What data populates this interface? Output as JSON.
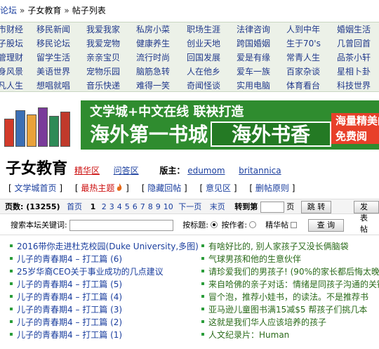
{
  "breadcrumb": {
    "items": [
      "论坛",
      "子女教育",
      "帖子列表"
    ],
    "separator": "»"
  },
  "categories": [
    [
      "市财经",
      "移民新闻",
      "我爱我家",
      "私房小菜",
      "职场生涯",
      "法律咨询",
      "人到中年",
      "婚姻生活"
    ],
    [
      "子股坛",
      "移民论坛",
      "我爱宠物",
      "健康养生",
      "创业天地",
      "跨国婚姻",
      "生于70's",
      "几曾回首"
    ],
    [
      "管理财",
      "留学生活",
      "亲亲宝贝",
      "流行时尚",
      "回国发展",
      "爱是有缘",
      "常青人生",
      "品茶小轩"
    ],
    [
      "身风景",
      "美语世界",
      "宠物乐园",
      "脑筋急转",
      "人在他乡",
      "爱车一族",
      "百家杂谈",
      "星相卜卦"
    ],
    [
      "凡人生",
      "想唱就唱",
      "音乐快递",
      "难得一笑",
      "奇闻怪谈",
      "实用电脑",
      "体育看台",
      "科技世界"
    ]
  ],
  "banner": {
    "slogan_top": "文学城+中文在线 联袂打造",
    "slogan_big": "海外第一书城",
    "box_title": "海外书香",
    "promo_line1": "海量精美的",
    "promo_line2": "免费阅"
  },
  "forum": {
    "title": "子女教育",
    "link_elite": "精华区",
    "link_qa": "问答区",
    "moderators_label": "版主：",
    "moderators": [
      "edumom",
      "britannica"
    ]
  },
  "toollinks": [
    "文学城首页",
    "最热主题",
    "隐藏回帖",
    "意见区",
    "删帖原则"
  ],
  "pager": {
    "pages_label": "页数: (13255)",
    "first": "首页",
    "current": "1",
    "pages": [
      "2",
      "3",
      "4",
      "5",
      "6",
      "7",
      "8",
      "9",
      "10"
    ],
    "next": "下一页",
    "last": "末页",
    "goto_label": "转到第",
    "goto_unit": "页",
    "go_button": "跳 转",
    "post_button": "发表帖"
  },
  "search": {
    "keyword_label": "搜索本坛关键词:",
    "by_title": "按标题:",
    "by_author": "按作者:",
    "elite_only": "精华帖",
    "query_button": "查 询"
  },
  "threads_left": [
    "2016带你走进杜克校园(Duke University,多图)",
    "儿子的青春期4 – 打工篇 (6)",
    "25岁华裔CEO关于事业成功的几点建议",
    "儿子的青春期4 – 打工篇 (5)",
    "儿子的青春期4 – 打工篇 (4)",
    "儿子的青春期4 – 打工篇 (3)",
    "儿子的青春期4 – 打工篇 (2)",
    "儿子的青春期4 – 打工篇 (1)"
  ],
  "threads_right": [
    "有啥好比的, 别人家孩子又没长俩脑袋",
    "气球男孩和他的生意伙伴",
    "请珍爱我们的男孩子! (90%的家长都后悔太晚",
    "来自哈佛的亲子对话：情绪是同孩子沟通的关键",
    "冒个泡，推荐小娃书，的读法。不是推荐书",
    "亚马逊儿童图书满15减$5 帮孩子们挑几本",
    "这就是我们华人应该培养的孩子",
    "人文纪录片：Human"
  ],
  "colors": {
    "link": "#1a3e9e",
    "accent_red": "#cc1111",
    "bullet": "#2a9d3a",
    "banner_green": "#2f8c2f",
    "grid_bg": "#ecf1e8"
  }
}
